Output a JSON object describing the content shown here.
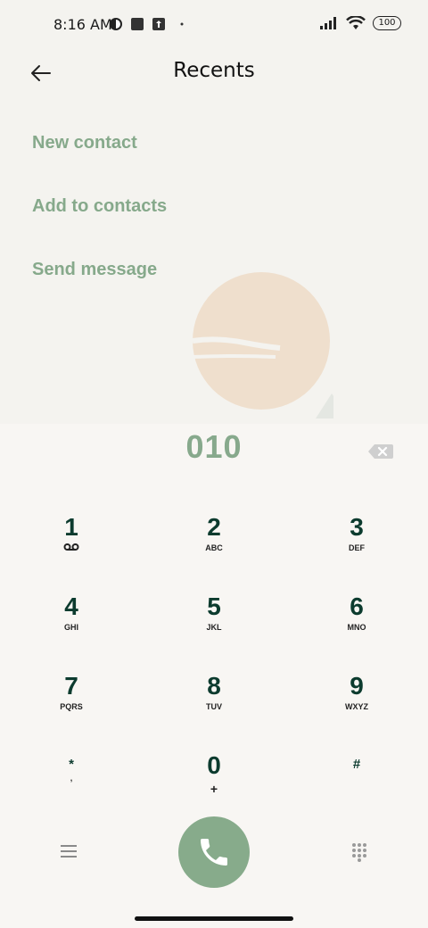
{
  "status_bar": {
    "time": "8:16 AM",
    "battery": "100"
  },
  "header": {
    "title": "Recents"
  },
  "actions": [
    "New contact",
    "Add to contacts",
    "Send message"
  ],
  "dial": {
    "number": "010"
  },
  "keys": [
    {
      "digit": "1",
      "letters": ""
    },
    {
      "digit": "2",
      "letters": "ABC"
    },
    {
      "digit": "3",
      "letters": "DEF"
    },
    {
      "digit": "4",
      "letters": "GHI"
    },
    {
      "digit": "5",
      "letters": "JKL"
    },
    {
      "digit": "6",
      "letters": "MNO"
    },
    {
      "digit": "7",
      "letters": "PQRS"
    },
    {
      "digit": "8",
      "letters": "TUV"
    },
    {
      "digit": "9",
      "letters": "WXYZ"
    },
    {
      "digit": "*",
      "letters": ","
    },
    {
      "digit": "0",
      "letters": "+"
    },
    {
      "digit": "#",
      "letters": ""
    }
  ],
  "colors": {
    "accent": "#87ab8b",
    "digit": "#0c3b2e",
    "background": "#f4f3ef"
  }
}
